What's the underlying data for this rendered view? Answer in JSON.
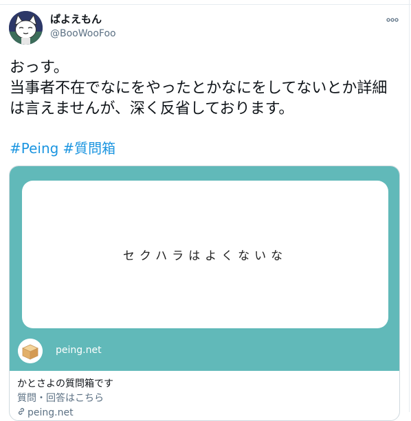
{
  "author": {
    "display_name": "ぱよえもん",
    "handle": "@BooWooFoo"
  },
  "tweet": {
    "text": "おっす。\n当事者不在でなにをやったとかなにをしてないとか詳細は言えませんが、深く反省しております。",
    "hashtags": [
      "#Peing",
      "#質問箱"
    ]
  },
  "card": {
    "question": "セクハラはよくないな",
    "site_name": "peing.net",
    "title": "かとさよの質問箱です",
    "description": "質問・回答はこちら",
    "domain": "peing.net"
  },
  "colors": {
    "card_teal": "#61b9b9",
    "hashtag_blue": "#1b95e0",
    "muted_text": "#5b7083"
  },
  "icons": {
    "more": "more-horizontal-icon",
    "link": "link-icon",
    "site_logo": "cardboard-box-icon"
  }
}
